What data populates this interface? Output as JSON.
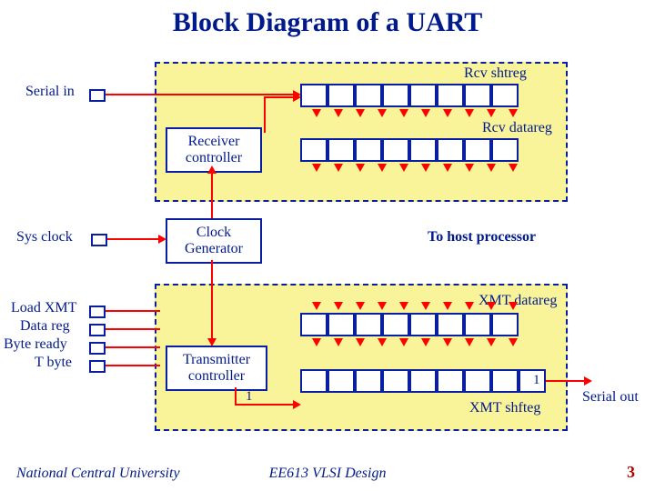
{
  "title": "Block Diagram of a UART",
  "labels": {
    "serial_in": "Serial in",
    "rcv_shtreg": "Rcv shtreg",
    "rcv_datareg": "Rcv datareg",
    "receiver_controller": "Receiver controller",
    "sys_clock": "Sys clock",
    "clock_generator": "Clock Generator",
    "to_host": "To host processor",
    "load_xmt": "Load XMT",
    "data_reg": "Data reg",
    "byte_ready": "Byte ready",
    "t_byte": "T byte",
    "xmt_datareg": "XMT datareg",
    "transmitter_controller": "Transmitter controller",
    "xmt_shfteg": "XMT shfteg",
    "serial_out": "Serial out",
    "one_a": "1",
    "one_b": "1"
  },
  "footer": {
    "left": "National Central University",
    "center": "EE613 VLSI Design",
    "right": "3"
  }
}
